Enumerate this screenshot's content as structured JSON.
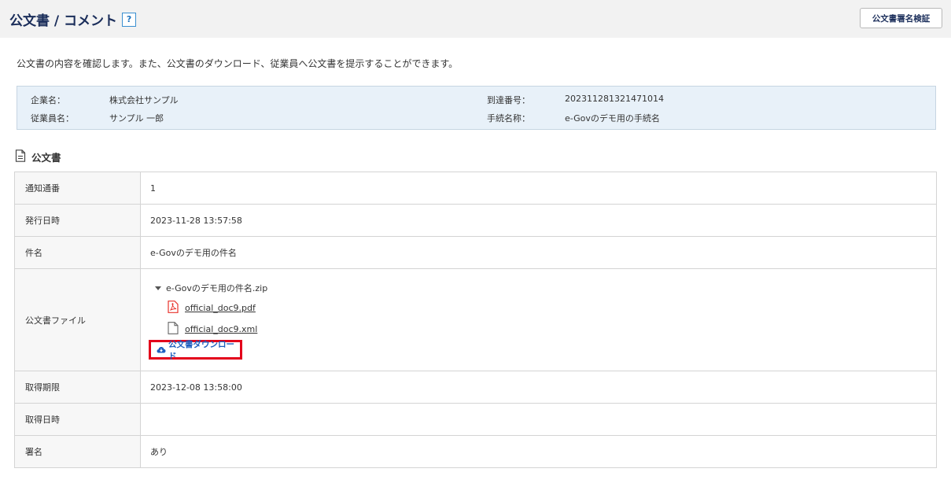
{
  "header": {
    "title": "公文書 / コメント",
    "help_label": "?",
    "verify_button_label": "公文書署名検証"
  },
  "description": "公文書の内容を確認します。また、公文書のダウンロード、従業員へ公文書を提示することができます。",
  "info": {
    "company_label": "企業名：",
    "company_value": "株式会社サンプル",
    "employee_label": "従業員名：",
    "employee_value": "サンプル 一郎",
    "arrival_label": "到達番号：",
    "arrival_value": "202311281321471014",
    "procedure_label": "手続名称：",
    "procedure_value": "e-Govのデモ用の手続名"
  },
  "section": {
    "title": "公文書"
  },
  "table": {
    "notice_no_label": "通知通番",
    "notice_no_value": "1",
    "issued_label": "発行日時",
    "issued_value": "2023-11-28 13:57:58",
    "subject_label": "件名",
    "subject_value": "e-Govのデモ用の件名",
    "files_label": "公文書ファイル",
    "zip_name": "e-Govのデモ用の件名.zip",
    "files": [
      "official_doc9.pdf",
      "official_doc9.xml"
    ],
    "download_label": "公文書ダウンロード",
    "deadline_label": "取得期限",
    "deadline_value": "2023-12-08 13:58:00",
    "acquired_label": "取得日時",
    "acquired_value": "",
    "signature_label": "署名",
    "signature_value": "あり"
  },
  "colors": {
    "header_bg": "#f2f2f2",
    "info_bg": "#e8f1f9",
    "link_blue": "#1e5fbf",
    "highlight_red": "#e3001b",
    "pdf_red": "#e8322b"
  }
}
